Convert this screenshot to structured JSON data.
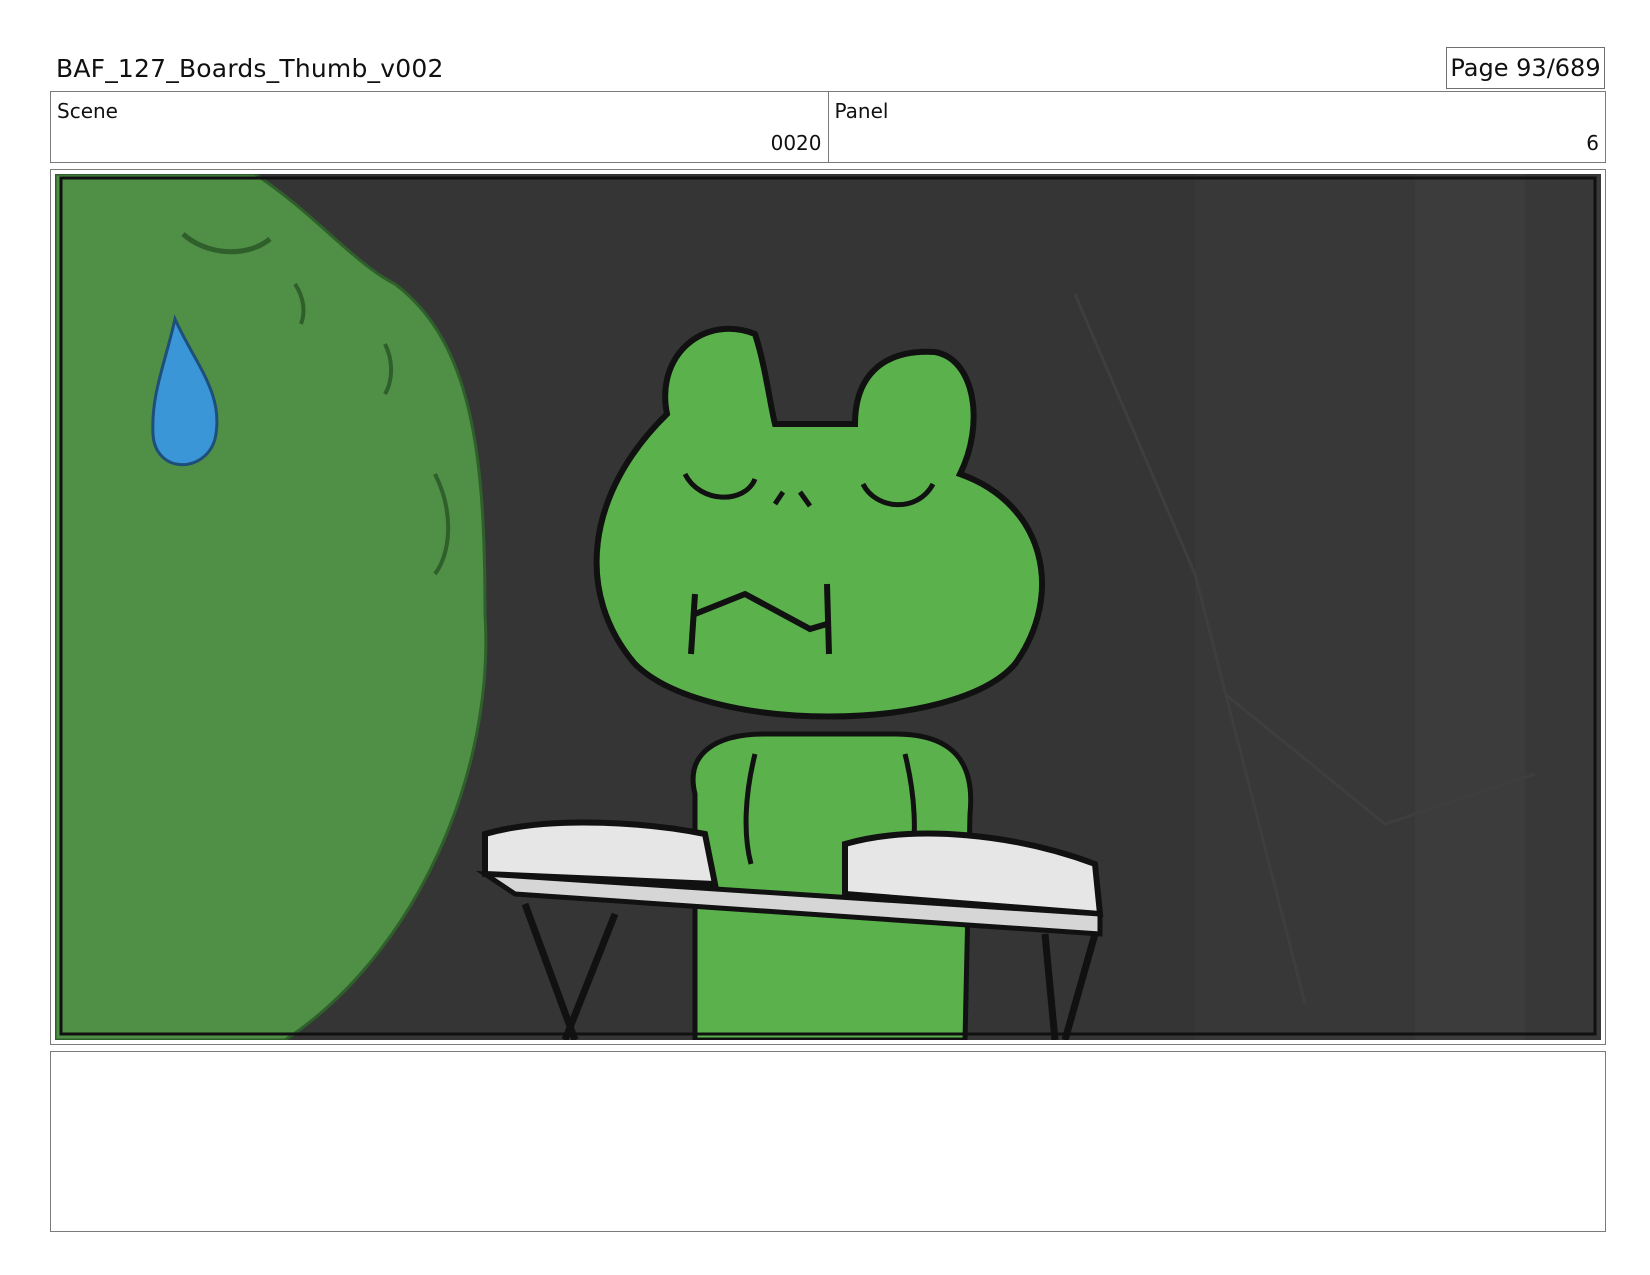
{
  "header": {
    "title": "BAF_127_Boards_Thumb_v002",
    "page_label": "Page",
    "page_number": "93/689"
  },
  "info": {
    "scene_label": "Scene",
    "scene_value": "0020",
    "panel_label": "Panel",
    "panel_value": "6"
  },
  "panel": {
    "description": "",
    "colors": {
      "background": "#353535",
      "frog_green": "#5bb24c",
      "big_green": "#4f8f46",
      "drop_blue": "#3b96d8",
      "book_gray": "#e6e6e6"
    }
  },
  "notes": {
    "text": ""
  }
}
